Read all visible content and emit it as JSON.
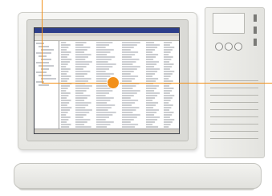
{
  "scene": {
    "description_items": [],
    "colors": {
      "accent": "#f2901a",
      "screen_title": "#2d3e8a",
      "bezel": "#e6e6e2",
      "tower": "#eeeeeb"
    },
    "icons": {
      "monitor": "monitor-icon",
      "tower": "desktop-tower-icon",
      "keyboard": "keyboard-icon",
      "marker": "callout-dot-icon"
    }
  }
}
